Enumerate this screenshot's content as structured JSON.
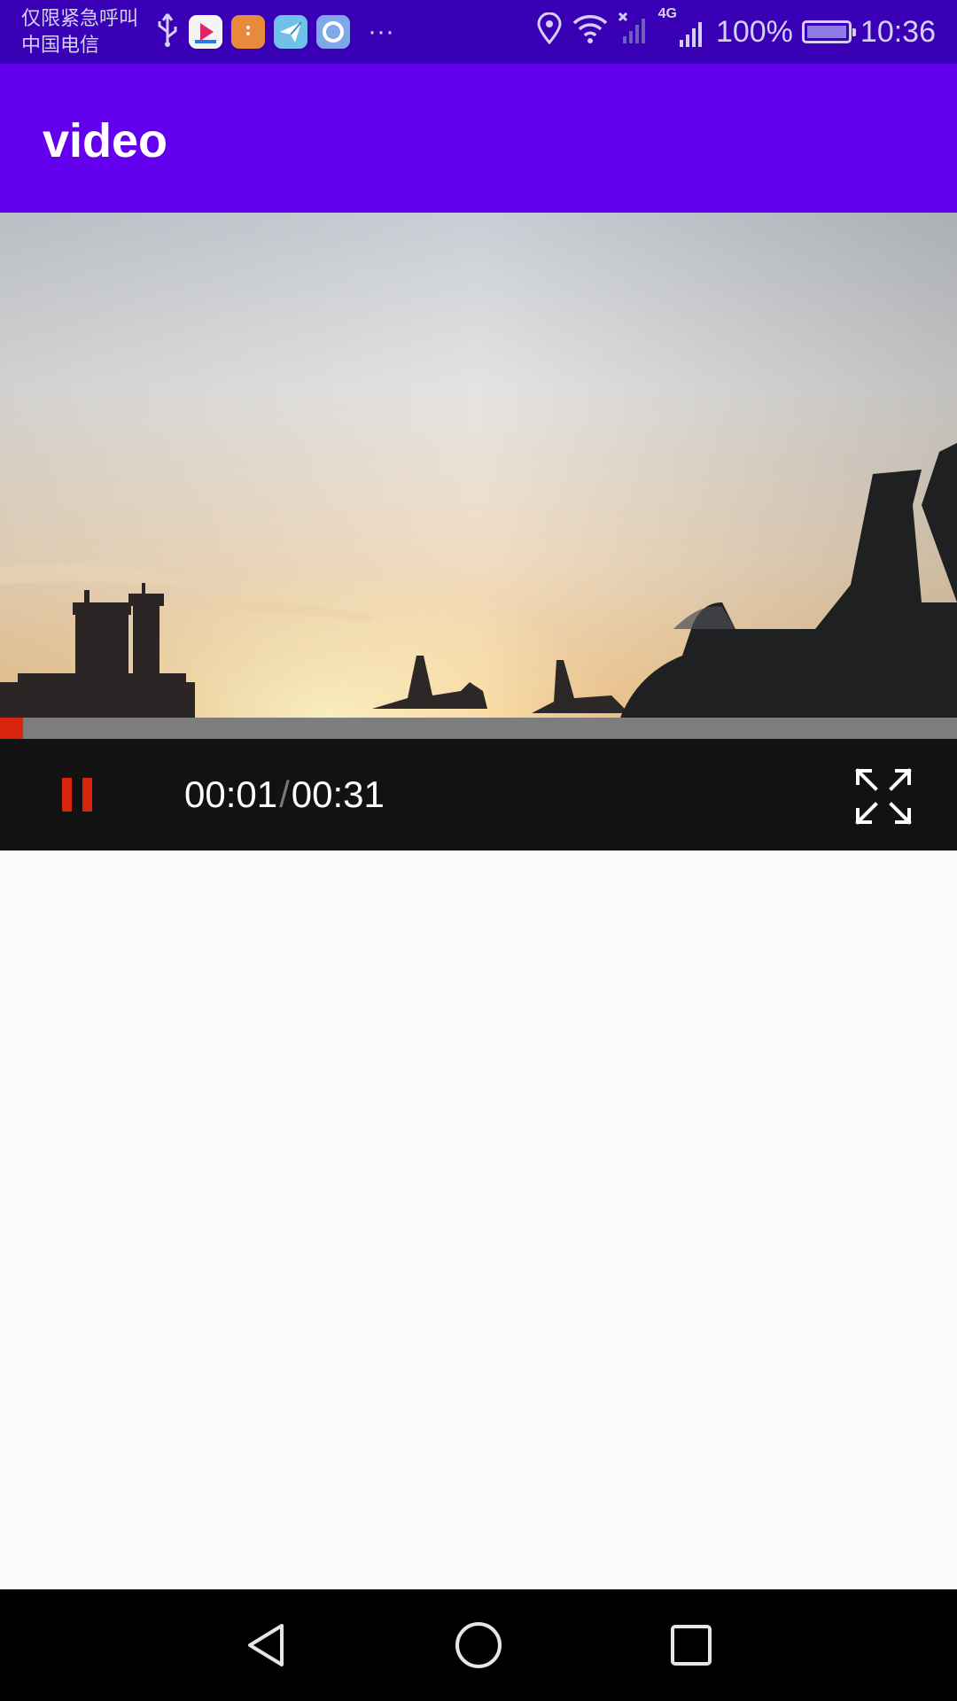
{
  "status_bar": {
    "carrier_line1": "仅限紧急呼叫",
    "carrier_line2": "中国电信",
    "overflow": "···",
    "network": "4G",
    "battery": "100%",
    "time": "10:36",
    "battery_level": 1.0
  },
  "app_bar": {
    "title": "video"
  },
  "player": {
    "current_time": "00:01",
    "separator": "/",
    "duration": "00:31",
    "progress": 0.024,
    "accent_color": "#d8240a"
  },
  "colors": {
    "status_bar": "#3a00b6",
    "app_bar": "#6200ee",
    "background": "#fafafa"
  },
  "icons": [
    "usb-icon",
    "youku-app-icon",
    "orange-app-icon",
    "paper-plane-app-icon",
    "browser-app-icon",
    "location-icon",
    "wifi-icon",
    "signal-icon",
    "battery-icon",
    "pause-icon",
    "fullscreen-icon",
    "back-icon",
    "home-icon",
    "recents-icon"
  ]
}
